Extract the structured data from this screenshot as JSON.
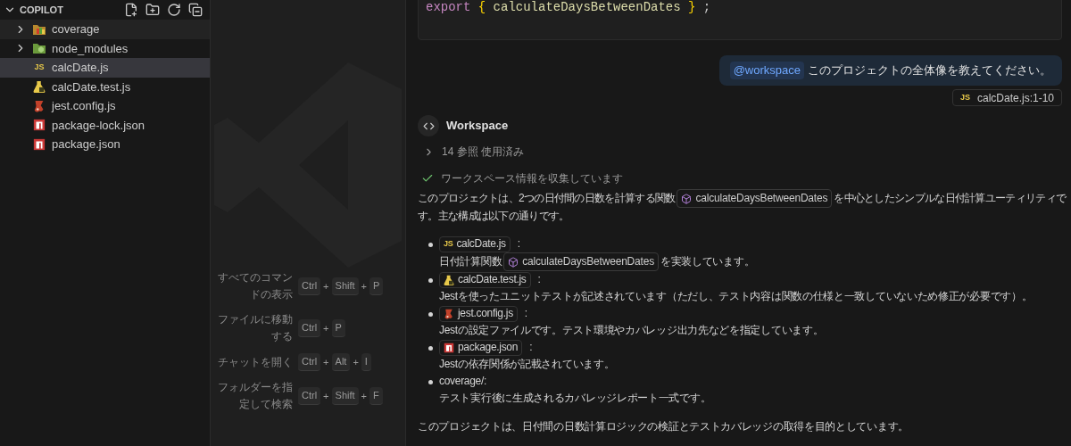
{
  "explorer": {
    "title": "COPILOT",
    "expanded": true,
    "items": [
      {
        "name": "coverage",
        "kind": "coverage",
        "expanded": false,
        "selected": false
      },
      {
        "name": "node_modules",
        "kind": "modules",
        "expanded": false,
        "selected": false
      },
      {
        "name": "calcDate.js",
        "kind": "js",
        "icon_label": "JS",
        "selected": true
      },
      {
        "name": "calcDate.test.js",
        "kind": "test",
        "selected": false
      },
      {
        "name": "jest.config.js",
        "kind": "jest",
        "selected": false
      },
      {
        "name": "package-lock.json",
        "kind": "npm",
        "selected": false
      },
      {
        "name": "package.json",
        "kind": "npm",
        "selected": false
      }
    ]
  },
  "shortcuts": [
    {
      "label": "すべてのコマンドの表示",
      "keys": [
        {
          "kind": "key",
          "text": "Ctrl"
        },
        {
          "kind": "plus",
          "text": "+"
        },
        {
          "kind": "key",
          "text": "Shift"
        },
        {
          "kind": "plus",
          "text": "+"
        },
        {
          "kind": "key",
          "text": "P"
        }
      ]
    },
    {
      "label": "ファイルに移動する",
      "keys": [
        {
          "kind": "key",
          "text": "Ctrl"
        },
        {
          "kind": "plus",
          "text": "+"
        },
        {
          "kind": "key",
          "text": "P"
        }
      ]
    },
    {
      "label": "チャットを開く",
      "keys": [
        {
          "kind": "key",
          "text": "Ctrl"
        },
        {
          "kind": "plus",
          "text": "+"
        },
        {
          "kind": "key",
          "text": "Alt"
        },
        {
          "kind": "plus",
          "text": "+"
        },
        {
          "kind": "key",
          "text": "I"
        }
      ]
    },
    {
      "label": "フォルダーを指定して検索",
      "keys": [
        {
          "kind": "key",
          "text": "Ctrl"
        },
        {
          "kind": "plus",
          "text": "+"
        },
        {
          "kind": "key",
          "text": "Shift"
        },
        {
          "kind": "plus",
          "text": "+"
        },
        {
          "kind": "key",
          "text": "F"
        }
      ]
    }
  ],
  "chat": {
    "code": [
      {
        "kind": "keyword",
        "text": "export"
      },
      {
        "kind": "brace",
        "text": "{"
      },
      {
        "kind": "function",
        "text": "calculateDaysBetweenDates"
      },
      {
        "kind": "brace",
        "text": "}"
      },
      {
        "kind": "punct",
        "text": ";"
      }
    ],
    "user_message": {
      "mention": "@workspace",
      "text": "このプロジェクトの全体像を教えてください。",
      "reference": {
        "kind": "js",
        "icon_label": "JS",
        "text": "calcDate.js:1-10"
      }
    },
    "response": {
      "agent": "Workspace",
      "references": {
        "text": "14 参照 使用済み",
        "expanded": false
      },
      "progress": {
        "text": "ワークスペース情報を収集しています",
        "done": true
      },
      "intro": [
        [
          {
            "kind": "text",
            "text": "このプロジェクトは、2つの日付間の日数を計算する関数"
          },
          {
            "kind": "symbol",
            "text": "calculateDaysBetweenDates"
          },
          {
            "kind": "text",
            "text": "を中心としたシンプルな日付計算ユーティリティで"
          }
        ],
        [
          {
            "kind": "text",
            "text": "す。主な構成は以下の通りです。"
          }
        ]
      ],
      "items": [
        {
          "kind": "js",
          "icon_label": "JS",
          "name": "calcDate.js",
          "suffix": ":",
          "description": [
            {
              "kind": "text",
              "text": "日付計算関数"
            },
            {
              "kind": "symbol",
              "text": "calculateDaysBetweenDates"
            },
            {
              "kind": "text",
              "text": "を実装しています。"
            }
          ]
        },
        {
          "kind": "test",
          "name": "calcDate.test.js",
          "suffix": ":",
          "description": [
            {
              "kind": "text",
              "text": "Jestを使ったユニットテストが記述されています（ただし、テスト内容は関数の仕様と一致していないため修正が必要です）。"
            }
          ]
        },
        {
          "kind": "jest",
          "name": "jest.config.js",
          "suffix": ":",
          "description": [
            {
              "kind": "text",
              "text": "Jestの設定ファイルです。テスト環境やカバレッジ出力先などを指定しています。"
            }
          ]
        },
        {
          "kind": "npm",
          "name": "package.json",
          "suffix": ":",
          "description": [
            {
              "kind": "text",
              "text": "Jestの依存関係が記載されています。"
            }
          ]
        },
        {
          "kind": "plain",
          "name": "coverage/:",
          "description": [
            {
              "kind": "text",
              "text": "テスト実行後に生成されるカバレッジレポート一式です。"
            }
          ]
        }
      ],
      "conclusion": "このプロジェクトは、日付間の日数計算ロジックの検証とテストカバレッジの取得を目的としています。"
    }
  }
}
